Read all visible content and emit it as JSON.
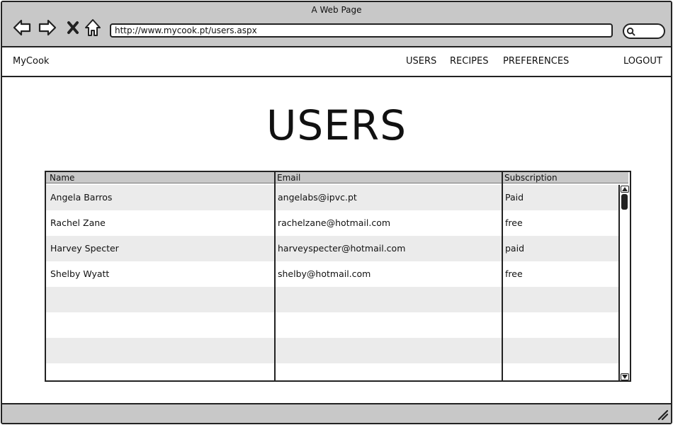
{
  "window": {
    "title": "A Web Page"
  },
  "browser": {
    "url": "http://www.mycook.pt/users.aspx"
  },
  "nav": {
    "brand": "MyCook",
    "links": [
      "USERS",
      "RECIPES",
      "PREFERENCES"
    ],
    "logout": "LOGOUT"
  },
  "page": {
    "title": "USERS"
  },
  "table": {
    "columns": [
      "Name",
      "Email",
      "Subscription"
    ],
    "rows": [
      [
        "Angela Barros",
        "angelabs@ipvc.pt",
        "Paid"
      ],
      [
        "Rachel Zane",
        "rachelzane@hotmail.com",
        "free"
      ],
      [
        "Harvey Specter",
        "harveyspecter@hotmail.com",
        "paid"
      ],
      [
        "Shelby Wyatt",
        "shelby@hotmail.com",
        "free"
      ]
    ]
  },
  "colors": {
    "chrome": "#c8c8c8",
    "row_alt": "#ebebeb",
    "border": "#222222"
  }
}
